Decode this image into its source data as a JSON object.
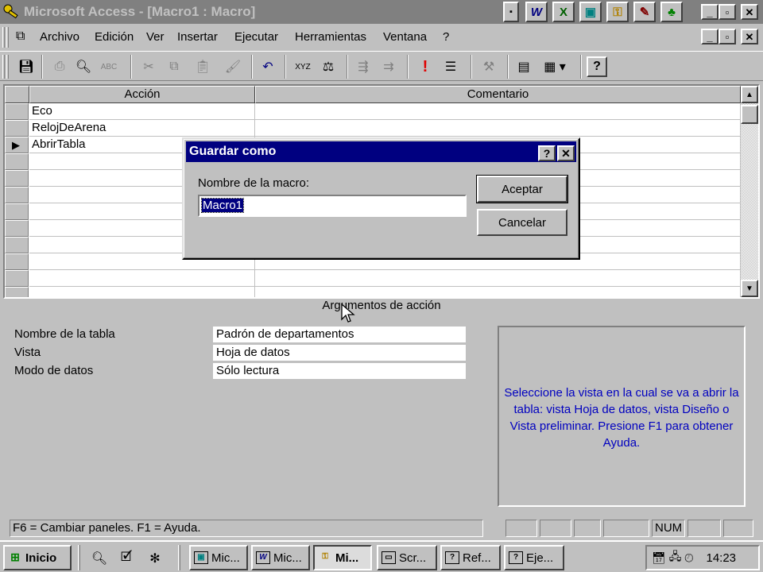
{
  "window": {
    "title": "Microsoft Access - [Macro1 : Macro]"
  },
  "menu": {
    "items": [
      "Archivo",
      "Edición",
      "Ver",
      "Insertar",
      "Ejecutar",
      "Herramientas",
      "Ventana",
      "?"
    ]
  },
  "grid": {
    "headers": {
      "action": "Acción",
      "comment": "Comentario"
    },
    "rows": [
      {
        "action": "Eco",
        "comment": ""
      },
      {
        "action": "RelojDeArena",
        "comment": ""
      },
      {
        "action": "AbrirTabla",
        "comment": ""
      }
    ],
    "current_row_marker": "▶"
  },
  "arguments": {
    "title": "Argumentos de acción",
    "fields": [
      {
        "label": "Nombre de la tabla",
        "value": "Padrón de departamentos"
      },
      {
        "label": "Vista",
        "value": "Hoja de datos"
      },
      {
        "label": "Modo de datos",
        "value": "Sólo lectura"
      }
    ],
    "help": "Seleccione la vista en la cual se va a abrir la tabla: vista Hoja de datos, vista Diseño o Vista preliminar. Presione F1 para obtener Ayuda."
  },
  "status": {
    "text": "F6 = Cambiar paneles.  F1 = Ayuda.",
    "num": "NUM"
  },
  "dialog": {
    "title": "Guardar como",
    "label": "Nombre de la macro:",
    "value": "Macro1",
    "ok": "Aceptar",
    "cancel": "Cancelar"
  },
  "taskbar": {
    "start": "Inicio",
    "buttons": [
      "Mic...",
      "Mic...",
      "Mi...",
      "Scr...",
      "Ref...",
      "Eje..."
    ],
    "clock": "14:23"
  }
}
